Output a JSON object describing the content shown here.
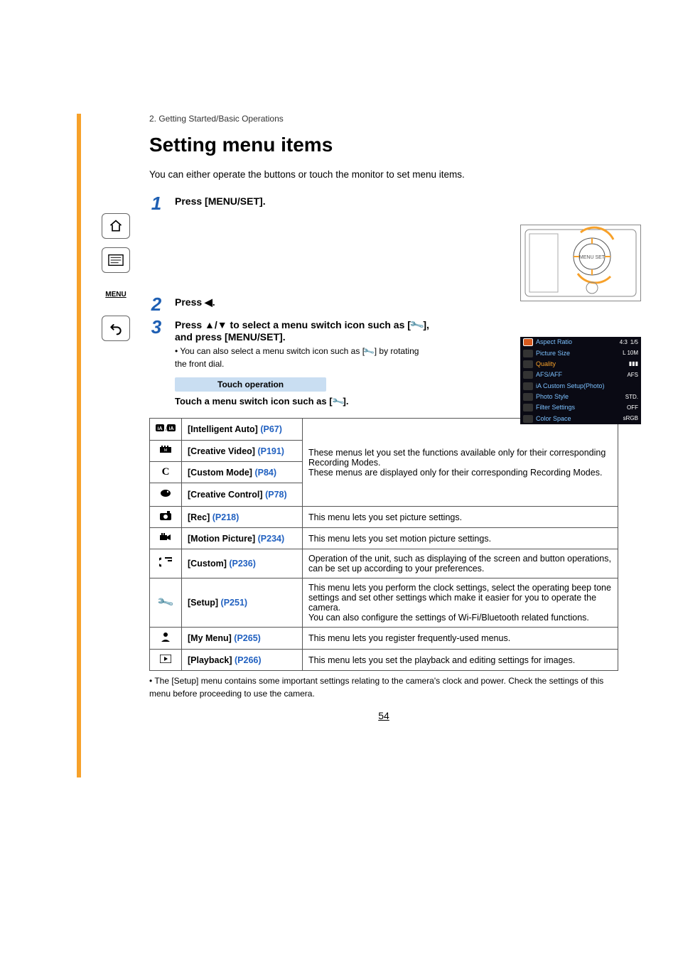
{
  "breadcrumb": "2. Getting Started/Basic Operations",
  "title": "Setting menu items",
  "intro": "You can either operate the buttons or touch the monitor to set menu items.",
  "steps": {
    "s1": {
      "num": "1",
      "title": "Press [MENU/SET]."
    },
    "s2": {
      "num": "2",
      "title": "Press ◀."
    },
    "s3": {
      "num": "3",
      "title_a": "Press ▲/▼ to select a menu switch icon such as [",
      "title_b": "], and press [MENU/SET].",
      "sub_a": "You can also select a menu switch icon such as [",
      "sub_b": "] by rotating the front dial.",
      "touch_label": "Touch operation",
      "touch_line_a": "Touch a menu switch icon such as [",
      "touch_line_b": "]."
    }
  },
  "menu_screen": {
    "rows": [
      {
        "label": "Aspect Ratio",
        "val": "4:3",
        "page": "1/5"
      },
      {
        "label": "Picture Size",
        "val": "L 10M"
      },
      {
        "label": "Quality",
        "val": "▮▮▮",
        "sel": true
      },
      {
        "label": "AFS/AFF",
        "val": "AFS"
      },
      {
        "label": "iA Custom Setup(Photo)",
        "val": ""
      },
      {
        "label": "Photo Style",
        "val": "STD."
      },
      {
        "label": "Filter Settings",
        "val": "OFF"
      },
      {
        "label": "Color Space",
        "val": "sRGB"
      }
    ]
  },
  "menu_table": {
    "desc1": "These menus let you set the functions available only for their corresponding Recording Modes.\nThese menus are displayed only for their corresponding Recording Modes.",
    "rows": [
      {
        "icon": "iA",
        "name": "[Intelligent Auto]",
        "ref": "(P67)"
      },
      {
        "icon": "film",
        "name": "[Creative Video]",
        "ref": "(P191)"
      },
      {
        "icon": "C",
        "name": "[Custom Mode]",
        "ref": "(P84)"
      },
      {
        "icon": "palette",
        "name": "[Creative Control]",
        "ref": "(P78)"
      },
      {
        "icon": "camera",
        "name": "[Rec]",
        "ref": "(P218)",
        "desc": "This menu lets you set picture settings."
      },
      {
        "icon": "video",
        "name": "[Motion Picture]",
        "ref": "(P234)",
        "desc": "This menu lets you set motion picture settings."
      },
      {
        "icon": "custom",
        "name": "[Custom]",
        "ref": "(P236)",
        "desc": "Operation of the unit, such as displaying of the screen and button operations, can be set up according to your preferences."
      },
      {
        "icon": "wrench",
        "name": "[Setup]",
        "ref": "(P251)",
        "desc": "This menu lets you perform the clock settings, select the operating beep tone settings and set other settings which make it easier for you to operate the camera.\nYou can also configure the settings of Wi-Fi/Bluetooth related functions."
      },
      {
        "icon": "person",
        "name": "[My Menu]",
        "ref": "(P265)",
        "desc": "This menu lets you register frequently-used menus."
      },
      {
        "icon": "play",
        "name": "[Playback]",
        "ref": "(P266)",
        "desc": "This menu lets you set the playback and editing settings for images."
      }
    ]
  },
  "footnote": "• The [Setup] menu contains some important settings relating to the camera's clock and power. Check the settings of this menu before proceeding to use the camera.",
  "pagenum": "54",
  "sidebar": {
    "menu_label": "MENU"
  }
}
